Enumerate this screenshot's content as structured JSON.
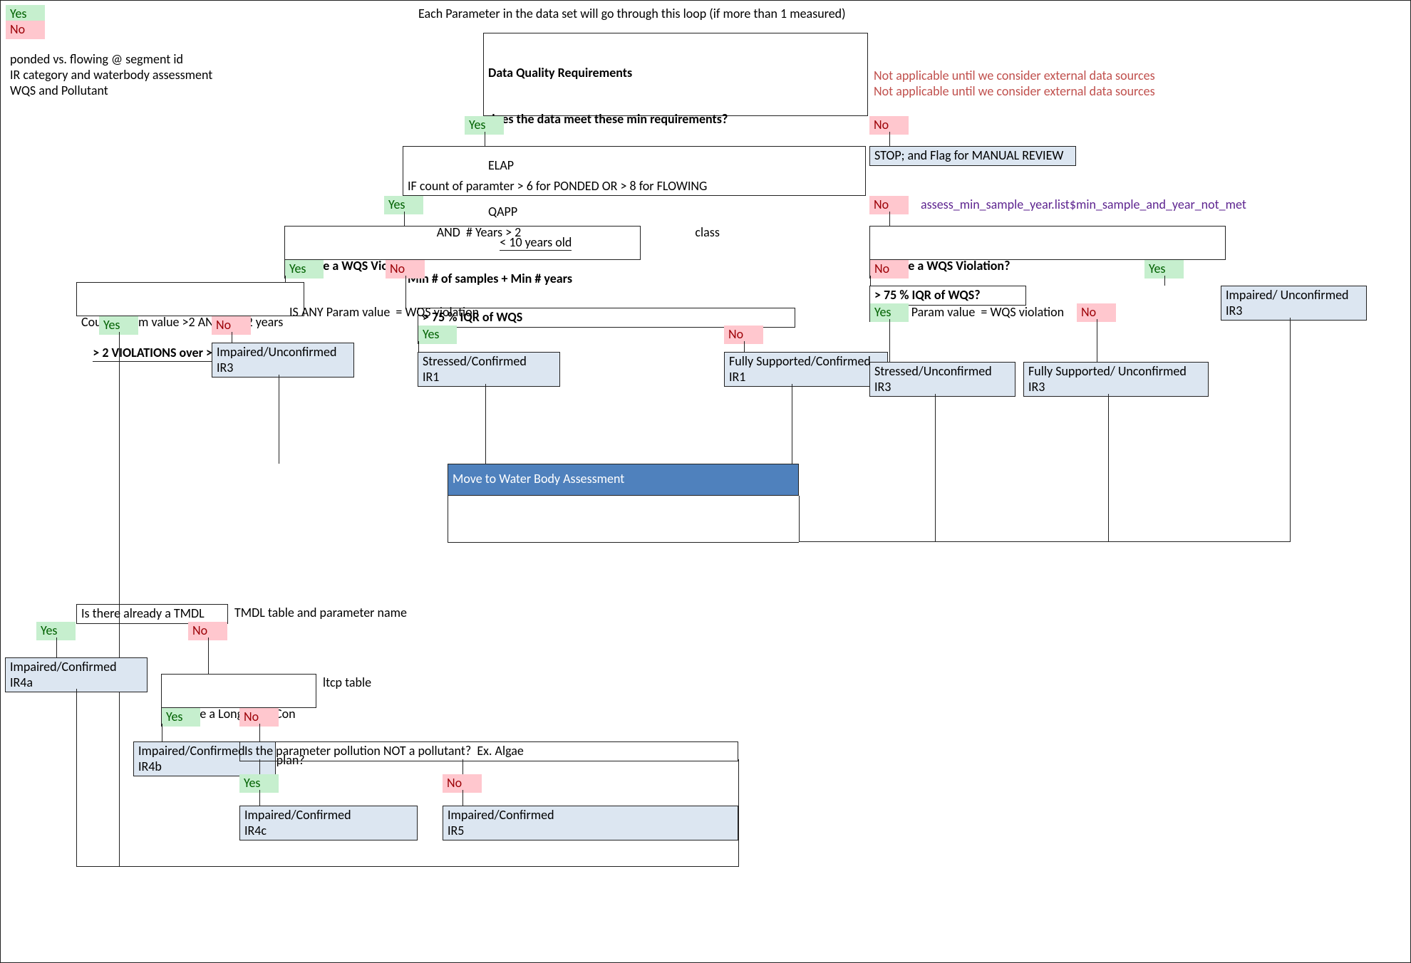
{
  "legend": {
    "yes": "Yes",
    "no": "No"
  },
  "title": "Each Parameter in the data set will go through this loop (if more than 1 measured)",
  "intro": {
    "l1": "ponded vs. flowing @ segment id",
    "l2": "IR category and waterbody assessment",
    "l3": "WQS and Pollutant"
  },
  "dq": {
    "h1": "Data Quality Requirements",
    "h2": "does the data meet these min requirements?",
    "r1": "ELAP",
    "r2": "QAPP",
    "r3": "< 10 years old",
    "na": "Not applicable until we consider external data sources",
    "yes": "Yes",
    "no": "No",
    "stop": "STOP; and Flag for MANUAL REVIEW"
  },
  "min": {
    "l1": "IF count of paramter > 6 for PONDED OR > 8 for FLOWING",
    "l2": "          AND  # Years > 2                                                            class",
    "h": "Min # of samples + Min # years",
    "yes": "Yes",
    "no": "No",
    "note": "assess_min_sample_year.list$min_sample_and_year_not_met"
  },
  "wqsL": {
    "h": "Is there a WQS Violation",
    "s": "IS ANY Param value  = WQS violation",
    "yes": "Yes",
    "no": "No"
  },
  "wqsR": {
    "h": "Is there a WQS Violation?",
    "s": "IS ANY Param value  = WQS violation",
    "yes": "Yes",
    "no": "No"
  },
  "countParam": {
    "l1": "Count Param value >2 AND in > 2 years",
    "h": "> 2 VIOLATIONS over >2 Years?",
    "yes": "Yes",
    "no": "No"
  },
  "iqrL": {
    "h": "> 75 % IQR of WQS",
    "yes": "Yes",
    "no": "No"
  },
  "iqrR": {
    "h": "> 75 % IQR of WQS?",
    "yes": "Yes",
    "no": "No"
  },
  "out": {
    "impUnc3_a": "Impaired/Unconfirmed\nIR3",
    "impUnc3_b": "Impaired/ Unconfirmed\nIR3",
    "stressConf1": "Stressed/Confirmed\nIR1",
    "fullConf1": "Fully Supported/Confirmed\nIR1",
    "stressUnc3": "Stressed/Unconfirmed\nIR3",
    "fullUnc3": "Fully Supported/ Unconfirmed\nIR3"
  },
  "move": "Move to Water Body Assessment",
  "tmdl": {
    "h": "Is there already a TMDL",
    "side": "TMDL table and parameter name",
    "yes": "Yes",
    "no": "No"
  },
  "ltcp": {
    "l1": "IS there a Long Term Con",
    "side": "ltcp table",
    "l2": "OR other restoration plan?",
    "yes": "Yes",
    "no": "No"
  },
  "pollutant": {
    "h": "Is the parameter pollution NOT a pollutant?  Ex. Algae",
    "yes": "Yes",
    "no": "No"
  },
  "final": {
    "ir4a": "Impaired/Confirmed\nIR4a",
    "ir4b": "Impaired/Confirmed\nIR4b",
    "ir4c": "Impaired/Confirmed\nIR4c",
    "ir5": "Impaired/Confirmed\nIR5"
  }
}
